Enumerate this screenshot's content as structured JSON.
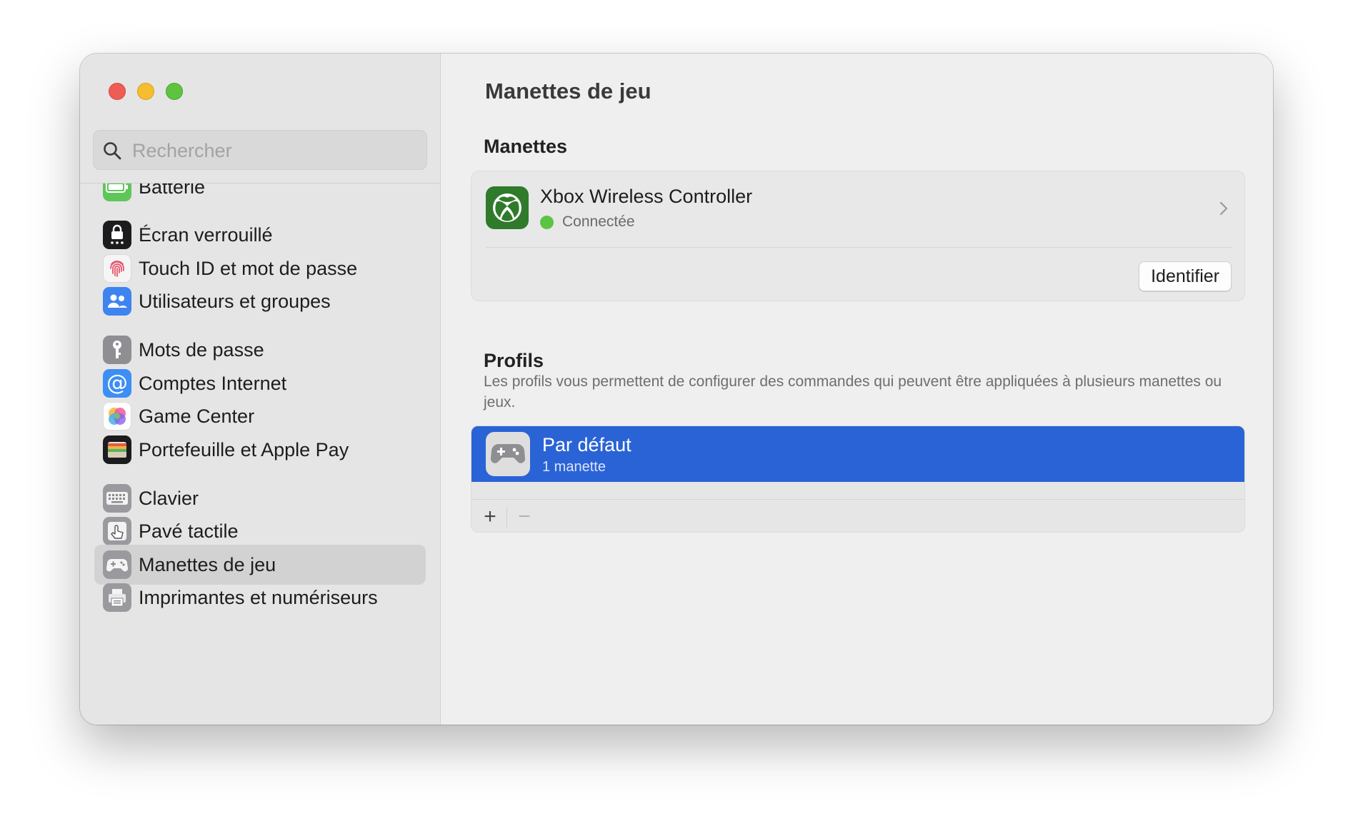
{
  "window": {
    "title": "Manettes de jeu"
  },
  "sidebar": {
    "search_placeholder": "Rechercher",
    "items": [
      {
        "label": "Batterie",
        "icon": "battery-icon",
        "color": "#5fc65a"
      },
      {
        "label": "Écran verrouillé",
        "icon": "lock-screen-icon",
        "color": "#1c1c1e"
      },
      {
        "label": "Touch ID et mot de passe",
        "icon": "fingerprint-icon",
        "color": "#f5f5f5"
      },
      {
        "label": "Utilisateurs et groupes",
        "icon": "users-icon",
        "color": "#3d84f0"
      },
      {
        "label": "Mots de passe",
        "icon": "key-icon",
        "color": "#8e8e93"
      },
      {
        "label": "Comptes Internet",
        "icon": "at-sign-icon",
        "color": "#3d8ef5"
      },
      {
        "label": "Game Center",
        "icon": "game-center-icon",
        "color": "#ffffff"
      },
      {
        "label": "Portefeuille et Apple Pay",
        "icon": "wallet-icon",
        "color": "#1c1c1e"
      },
      {
        "label": "Clavier",
        "icon": "keyboard-icon",
        "color": "#9a9a9e"
      },
      {
        "label": "Pavé tactile",
        "icon": "trackpad-icon",
        "color": "#9a9a9e"
      },
      {
        "label": "Manettes de jeu",
        "icon": "gamepad-icon",
        "color": "#9a9a9e",
        "selected": true
      },
      {
        "label": "Imprimantes et numériseurs",
        "icon": "printer-icon",
        "color": "#9a9a9e"
      }
    ]
  },
  "main": {
    "title": "Manettes de jeu",
    "controllers": {
      "heading": "Manettes",
      "items": [
        {
          "name": "Xbox Wireless Controller",
          "status": "Connectée",
          "status_color": "#5cc445"
        }
      ],
      "identify_label": "Identifier"
    },
    "profiles": {
      "heading": "Profils",
      "description": "Les profils vous permettent de configurer des commandes qui peuvent être appliquées à plusieurs manettes ou jeux.",
      "items": [
        {
          "name": "Par défaut",
          "subtitle": "1 manette",
          "selected": true
        }
      ],
      "add_label": "+",
      "remove_label": "−"
    }
  },
  "colors": {
    "accent": "#2a63d6",
    "xbox_green": "#2f7a2b",
    "sidebar_bg": "#e5e5e5",
    "content_bg": "#efefef"
  }
}
